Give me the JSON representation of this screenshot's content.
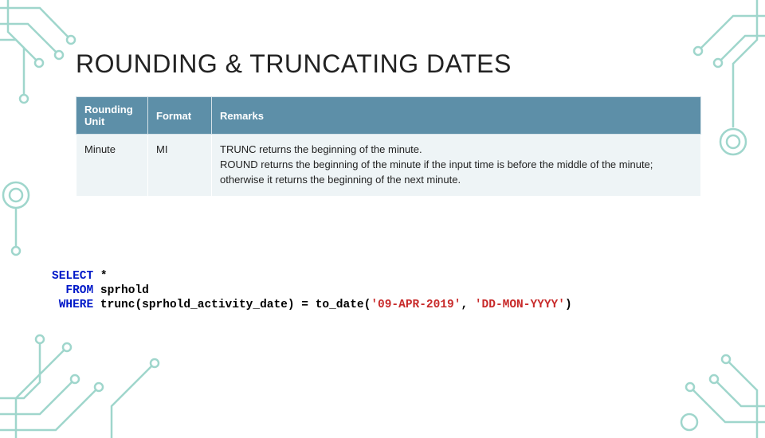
{
  "title": "ROUNDING & TRUNCATING DATES",
  "table": {
    "headers": {
      "h1": "Rounding Unit",
      "h2": "Format",
      "h3": "Remarks"
    },
    "row": {
      "unit": "Minute",
      "format": "MI",
      "remarks_line1": "TRUNC returns the beginning of the minute.",
      "remarks_line2": "ROUND returns the beginning of the minute if the input time is before the middle of the minute; otherwise it returns the beginning of the next minute."
    }
  },
  "sql": {
    "kw_select": "SELECT",
    "star": " *",
    "kw_from": "  FROM",
    "tbl": " sprhold",
    "kw_where": " WHERE",
    "fn_trunc": " trunc",
    "paren_open1": "(",
    "col": "sprhold_activity_date",
    "paren_close1": ")",
    "eq": " = ",
    "fn_todate": "to_date",
    "paren_open2": "(",
    "str1": "'09-APR-2019'",
    "comma": ", ",
    "str2": "'DD-MON-YYYY'",
    "paren_close2": ")"
  }
}
